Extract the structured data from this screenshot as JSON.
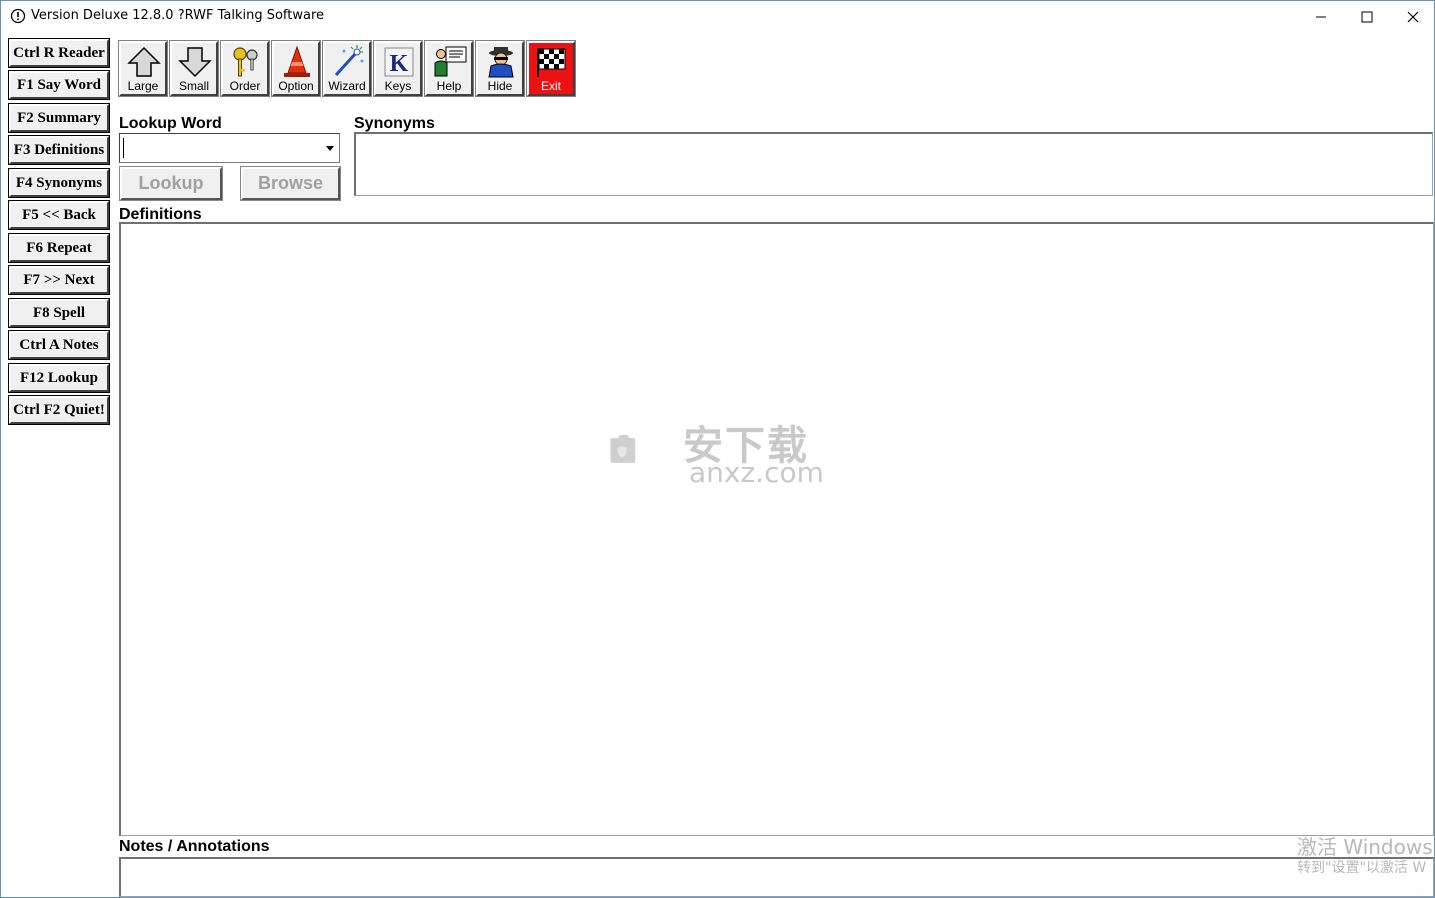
{
  "window": {
    "title": "Version Deluxe 12.8.0 ?RWF Talking Software"
  },
  "sidebar": {
    "items": [
      {
        "label": "Ctrl R Reader"
      },
      {
        "label": "F1 Say Word"
      },
      {
        "label": "F2 Summary"
      },
      {
        "label": "F3 Definitions"
      },
      {
        "label": "F4 Synonyms"
      },
      {
        "label": "F5 << Back"
      },
      {
        "label": "F6 Repeat"
      },
      {
        "label": "F7 >> Next"
      },
      {
        "label": "F8 Spell"
      },
      {
        "label": "Ctrl A Notes"
      },
      {
        "label": "F12 Lookup"
      },
      {
        "label": "Ctrl F2 Quiet!"
      }
    ]
  },
  "toolbar": {
    "items": [
      {
        "label": "Large",
        "icon": "up-arrow-icon"
      },
      {
        "label": "Small",
        "icon": "down-arrow-icon"
      },
      {
        "label": "Order",
        "icon": "keys-icon"
      },
      {
        "label": "Option",
        "icon": "traffic-cone-icon"
      },
      {
        "label": "Wizard",
        "icon": "magic-wand-icon"
      },
      {
        "label": "Keys",
        "icon": "letter-k-icon"
      },
      {
        "label": "Help",
        "icon": "help-person-icon"
      },
      {
        "label": "Hide",
        "icon": "spy-icon"
      },
      {
        "label": "Exit",
        "icon": "checkered-flag-icon"
      }
    ],
    "exit_color": "#ee1111"
  },
  "lookup": {
    "label": "Lookup Word",
    "value": "",
    "lookup_button": "Lookup",
    "browse_button": "Browse"
  },
  "synonyms": {
    "label": "Synonyms"
  },
  "definitions": {
    "label": "Definitions"
  },
  "notes": {
    "label": "Notes / Annotations"
  },
  "watermark": {
    "line1": "安下载",
    "line2": "anxz.com"
  },
  "activation": {
    "line1": "激活 Windows",
    "line2": "转到\"设置\"以激活 W"
  }
}
